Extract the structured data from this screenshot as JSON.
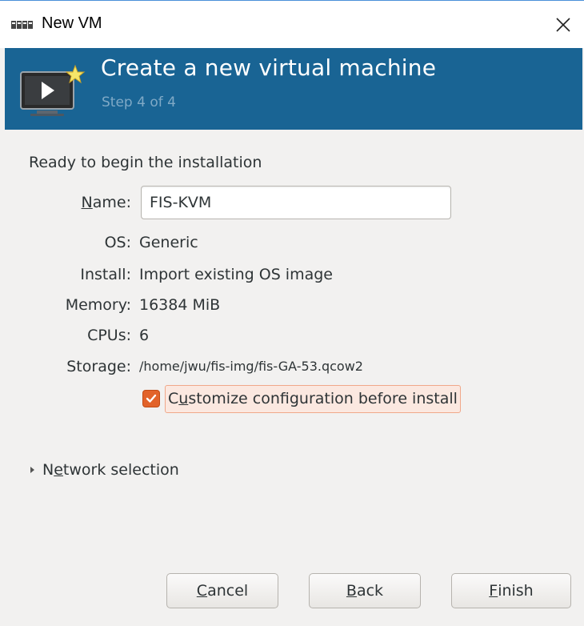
{
  "window": {
    "title": "New VM",
    "close_icon": "close-icon",
    "app_icon": "virt-manager-icon"
  },
  "banner": {
    "title": "Create a new virtual machine",
    "step": "Step 4 of 4",
    "icon": "new-vm-monitor-icon",
    "color": "#196494"
  },
  "summary": {
    "heading": "Ready to begin the installation",
    "name_label_mnemonic": "N",
    "name_label_rest": "ame:",
    "name_value": "FIS-KVM",
    "os_label": "OS:",
    "os_value": "Generic",
    "install_label": "Install:",
    "install_value": "Import existing OS image",
    "memory_label": "Memory:",
    "memory_value": "16384 MiB",
    "cpus_label": "CPUs:",
    "cpus_value": "6",
    "storage_label": "Storage:",
    "storage_value": "/home/jwu/fis-img/fis-GA-53.qcow2"
  },
  "customize": {
    "checked": true,
    "label_pre": "C",
    "label_mnemonic": "u",
    "label_post": "stomize configuration before install",
    "accent": "#e2632a"
  },
  "network": {
    "expanded": false,
    "label_pre": "N",
    "label_mnemonic": "e",
    "label_post": "twork selection"
  },
  "buttons": {
    "cancel_mnemonic": "C",
    "cancel_rest": "ancel",
    "back_mnemonic": "B",
    "back_rest": "ack",
    "finish_mnemonic": "F",
    "finish_rest": "inish"
  }
}
